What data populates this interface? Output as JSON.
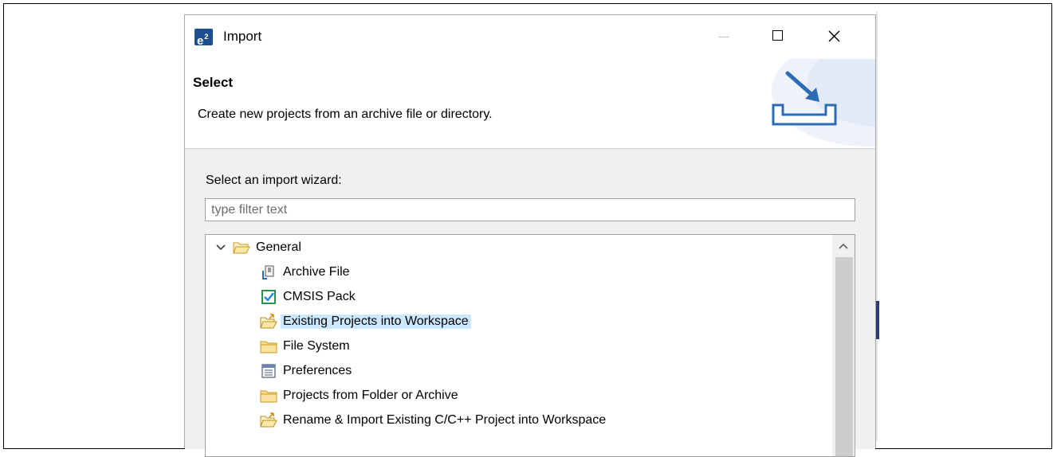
{
  "dialog": {
    "title": "Import",
    "app_icon": "e2-studio-icon",
    "controls": {
      "minimize": "minimize-icon",
      "maximize": "maximize-icon",
      "close": "close-icon"
    }
  },
  "header": {
    "title": "Select",
    "description": "Create new projects from an archive file or directory."
  },
  "wizard": {
    "label": "Select an import wizard:",
    "filter_placeholder": "type filter text",
    "filter_value": "",
    "tree": {
      "category": "General",
      "items": [
        {
          "label": "Archive File",
          "icon": "archive-file-icon"
        },
        {
          "label": "CMSIS Pack",
          "icon": "cmsis-pack-icon"
        },
        {
          "label": "Existing Projects into Workspace",
          "icon": "existing-projects-icon",
          "selected": true
        },
        {
          "label": "File System",
          "icon": "folder-icon"
        },
        {
          "label": "Preferences",
          "icon": "preferences-icon"
        },
        {
          "label": "Projects from Folder or Archive",
          "icon": "folder-icon"
        },
        {
          "label": "Rename & Import Existing C/C++ Project into Workspace",
          "icon": "rename-import-icon"
        }
      ]
    }
  },
  "colors": {
    "selection": "#cce8ff",
    "content_bg": "#f0f0f0",
    "app_icon": "#1d4f8f"
  }
}
